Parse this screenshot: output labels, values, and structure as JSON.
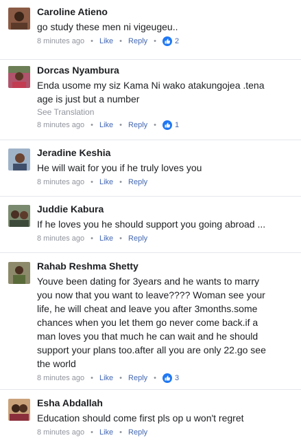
{
  "comments": [
    {
      "name": "Caroline Atieno",
      "lines": [
        "go study these men ni vigeugeu.."
      ],
      "time": "8 minutes ago",
      "like_label": "Like",
      "reply_label": "Reply",
      "likes": "2",
      "avatar": "avatar-photo"
    },
    {
      "name": "Dorcas Nyambura",
      "lines": [
        "Enda usome my siz Kama Ni wako atakungojea .tena",
        "age is just but a number"
      ],
      "translation": "See Translation",
      "time": "8 minutes ago",
      "like_label": "Like",
      "reply_label": "Reply",
      "likes": "1",
      "avatar": "avatar-photo"
    },
    {
      "name": "Jeradine Keshia",
      "lines": [
        "He will wait for you if he truly loves you"
      ],
      "time": "8 minutes ago",
      "like_label": "Like",
      "reply_label": "Reply",
      "avatar": "avatar-photo"
    },
    {
      "name": "Juddie Kabura",
      "lines": [
        "If he loves you he should support you going abroad ..."
      ],
      "time": "8 minutes ago",
      "like_label": "Like",
      "reply_label": "Reply",
      "avatar": "avatar-photo"
    },
    {
      "name": "Rahab Reshma Shetty",
      "lines": [
        "Youve been dating for 3years and he wants to marry",
        "you now that you want to leave???? Woman see your",
        "life, he will cheat and leave you after 3months.some",
        "chances when you let them go never come back.if a",
        "man loves you that much he can wait and he should",
        "support your plans too.after all you are only 22.go see",
        "the world"
      ],
      "time": "8 minutes ago",
      "like_label": "Like",
      "reply_label": "Reply",
      "likes": "3",
      "avatar": "avatar-photo"
    },
    {
      "name": "Esha Abdallah",
      "lines": [
        "Education should come first pls op u won't regret"
      ],
      "time": "8 minutes ago",
      "like_label": "Like",
      "reply_label": "Reply",
      "avatar": "avatar-photo"
    }
  ],
  "separator": "•",
  "colors": {
    "link": "#4267b2",
    "meta": "#90949c",
    "text": "#1c1e21",
    "like_badge": "#2078f4"
  },
  "icons": {
    "like_badge": "thumbs-up-icon"
  }
}
